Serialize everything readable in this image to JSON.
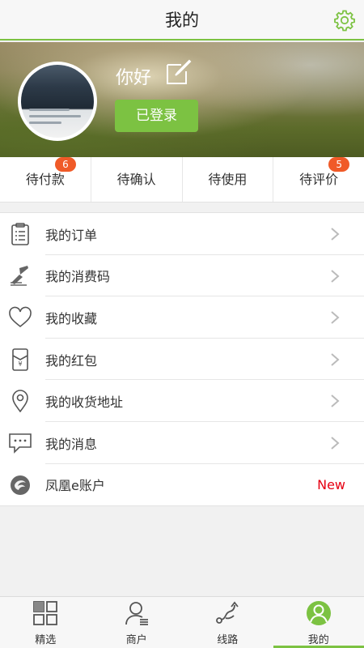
{
  "header": {
    "title": "我的",
    "settings_icon": "gear-icon",
    "accent": "#7cc242"
  },
  "profile": {
    "greeting": "你好",
    "login_label": "已登录",
    "edit_icon": "edit-icon"
  },
  "order_status": [
    {
      "label": "待付款",
      "badge": "6"
    },
    {
      "label": "待确认",
      "badge": ""
    },
    {
      "label": "待使用",
      "badge": ""
    },
    {
      "label": "待评价",
      "badge": "5"
    }
  ],
  "menu": [
    {
      "label": "我的订单",
      "icon": "clipboard-icon"
    },
    {
      "label": "我的消费码",
      "icon": "brush-icon"
    },
    {
      "label": "我的收藏",
      "icon": "heart-icon"
    },
    {
      "label": "我的红包",
      "icon": "red-envelope-icon"
    },
    {
      "label": "我的收货地址",
      "icon": "location-pin-icon"
    },
    {
      "label": "我的消息",
      "icon": "message-icon"
    },
    {
      "label": "凤凰e账户",
      "icon": "phoenix-logo-icon",
      "tag": "New"
    }
  ],
  "tabs": [
    {
      "label": "精选",
      "icon": "grid-icon"
    },
    {
      "label": "商户",
      "icon": "merchant-icon"
    },
    {
      "label": "线路",
      "icon": "route-icon"
    },
    {
      "label": "我的",
      "icon": "profile-icon",
      "active": true
    }
  ]
}
